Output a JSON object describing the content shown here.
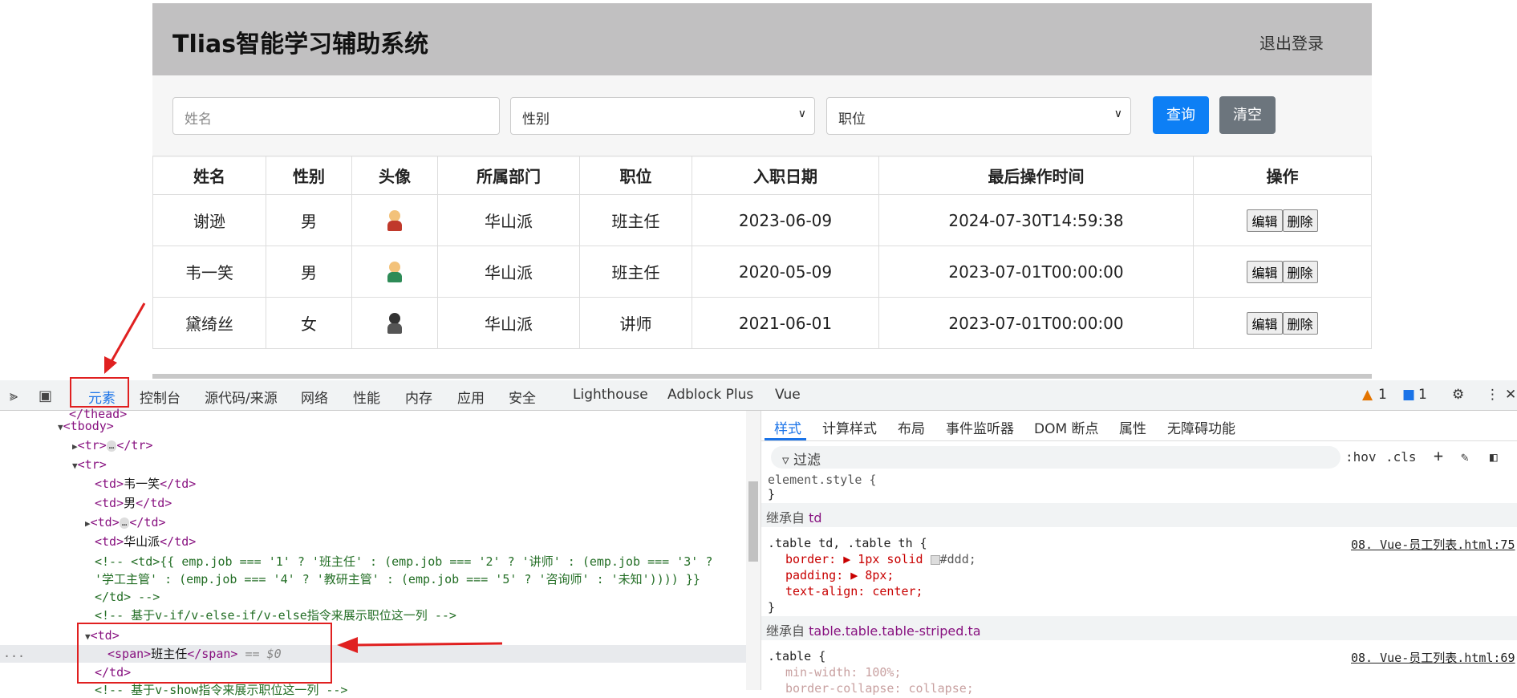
{
  "app": {
    "title": "Tlias智能学习辅助系统",
    "logout": "退出登录",
    "search": {
      "name_placeholder": "姓名",
      "gender_selected": "性别",
      "job_selected": "职位",
      "query_label": "查询",
      "clear_label": "清空"
    },
    "table": {
      "headers": [
        "姓名",
        "性别",
        "头像",
        "所属部门",
        "职位",
        "入职日期",
        "最后操作时间",
        "操作"
      ],
      "rows": [
        {
          "name": "谢逊",
          "gender": "男",
          "dept": "华山派",
          "job": "班主任",
          "entry": "2023-06-09",
          "updated": "2024-07-30T14:59:38",
          "edit": "编辑",
          "del": "删除"
        },
        {
          "name": "韦一笑",
          "gender": "男",
          "dept": "华山派",
          "job": "班主任",
          "entry": "2020-05-09",
          "updated": "2023-07-01T00:00:00",
          "edit": "编辑",
          "del": "删除"
        },
        {
          "name": "黛绮丝",
          "gender": "女",
          "dept": "华山派",
          "job": "讲师",
          "entry": "2021-06-01",
          "updated": "2023-07-01T00:00:00",
          "edit": "编辑",
          "del": "删除"
        }
      ]
    }
  },
  "devtools": {
    "tabs": [
      "元素",
      "控制台",
      "源代码/来源",
      "网络",
      "性能",
      "内存",
      "应用",
      "安全",
      "Lighthouse",
      "Adblock Plus",
      "Vue"
    ],
    "warn_count": "1",
    "msg_count": "1",
    "elements": {
      "l0": "</thead>",
      "l1": "<tbody>",
      "l2a": "<tr>",
      "l2b": "</tr>",
      "l3": "<tr>",
      "l4a": "<td>",
      "l4t": "韦一笑",
      "l4b": "</td>",
      "l5t": "男",
      "l7t": "华山派",
      "l8": "<!-- <td>{{ emp.job === '1' ? '班主任' : (emp.job === '2' ? '讲师' : (emp.job === '3' ?",
      "l9": "'学工主管' : (emp.job === '4' ? '教研主管' : (emp.job === '5' ? '咨询师' : '未知')))) }}",
      "l10": "</td> -->",
      "l11": "<!-- 基于v-if/v-else-if/v-else指令来展示职位这一列 -->",
      "l12": "<td>",
      "l13a": "<span>",
      "l13t": "班主任",
      "l13b": "</span>",
      "l13c": "== $0",
      "l14": "</td>",
      "l15": "<!-- 基于v-show指令来展示职位这一列 -->",
      "ellipsis": "…",
      "gutter": "..."
    },
    "styles": {
      "tabs": [
        "样式",
        "计算样式",
        "布局",
        "事件监听器",
        "DOM 断点",
        "属性",
        "无障碍功能"
      ],
      "filter": "过滤",
      "hov": ":hov",
      "cls": ".cls",
      "element_style": "element.style {",
      "close": "}",
      "inherit1_label": "继承自",
      "inherit1_sel": "td",
      "rule1_sel": ".table td, .table th {",
      "rule1_src": "08. Vue-员工列表.html:75",
      "rule1_p1": "border: ▶ 1px solid",
      "rule1_p1c": "#ddd;",
      "rule1_p2": "padding: ▶ 8px;",
      "rule1_p3": "text-align: center;",
      "inherit2_label": "继承自",
      "inherit2_sel": "table.table.table-striped.ta",
      "rule2_sel": ".table {",
      "rule2_src": "08. Vue-员工列表.html:69",
      "rule2_p1": "min-width: 100%;",
      "rule2_p2": "border-collapse: collapse;"
    }
  }
}
